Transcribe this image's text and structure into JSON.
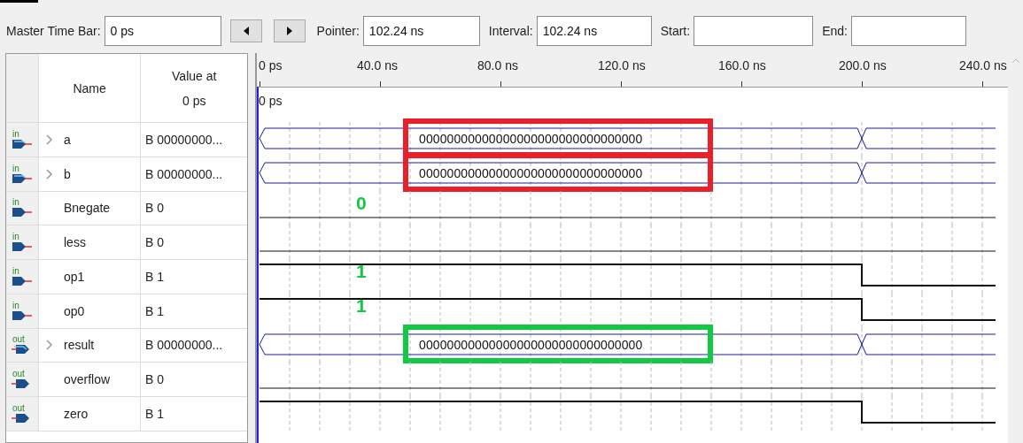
{
  "toolbar": {
    "master_time_bar": {
      "label": "Master Time Bar:",
      "value": "0 ps"
    },
    "buttons": [
      {
        "kind": "left"
      },
      {
        "kind": "right"
      }
    ],
    "pointer": {
      "label": "Pointer:",
      "value": "102.24 ns"
    },
    "interval": {
      "label": "Interval:",
      "value": "102.24 ns"
    },
    "start": {
      "label": "Start:"
    },
    "end": {
      "label": "End:"
    }
  },
  "table": {
    "columns": [
      "Name",
      "Value at\n0 ps"
    ]
  },
  "timeline": {
    "ticks": [
      "0 ps",
      "40.0 ns",
      "80.0 ns",
      "120.0 ns",
      "160.0 ns",
      "200.0 ns",
      "240.0 ns"
    ],
    "cursor": "0 ps"
  },
  "signals": [
    {
      "direction": "in",
      "kind": "bus",
      "expandable": true,
      "name": "a",
      "value": "B 00000000...",
      "bus_text": "00000000000000000000000000000000",
      "annotation": {
        "kind": "box",
        "color": "#e8202a"
      }
    },
    {
      "direction": "in",
      "kind": "bus",
      "expandable": true,
      "name": "b",
      "value": "B 00000000...",
      "bus_text": "00000000000000000000000000000000",
      "annotation": {
        "kind": "box",
        "color": "#e8202a"
      }
    },
    {
      "direction": "in",
      "kind": "bit",
      "expandable": false,
      "name": "Bnegate",
      "value": "B 0",
      "starts_high": false,
      "ends_high": false,
      "annotation": {
        "kind": "label",
        "color": "#12c944",
        "text": "0"
      }
    },
    {
      "direction": "in",
      "kind": "bit",
      "expandable": false,
      "name": "less",
      "value": "B 0",
      "starts_high": false,
      "ends_high": false
    },
    {
      "direction": "in",
      "kind": "bit",
      "expandable": false,
      "name": "op1",
      "value": "B 1",
      "starts_high": true,
      "ends_high": false,
      "annotation": {
        "kind": "label",
        "color": "#12c944",
        "text": "1"
      }
    },
    {
      "direction": "in",
      "kind": "bit",
      "expandable": false,
      "name": "op0",
      "value": "B 1",
      "starts_high": true,
      "ends_high": false,
      "annotation": {
        "kind": "label",
        "color": "#12c944",
        "text": "1"
      }
    },
    {
      "direction": "out",
      "kind": "bus",
      "expandable": true,
      "name": "result",
      "value": "B 00000000...",
      "bus_text": "00000000000000000000000000000000",
      "annotation": {
        "kind": "box",
        "color": "#12c944"
      }
    },
    {
      "direction": "out",
      "kind": "bit",
      "expandable": false,
      "name": "overflow",
      "value": "B 0",
      "starts_high": false,
      "ends_high": false
    },
    {
      "direction": "out",
      "kind": "bit",
      "expandable": false,
      "name": "zero",
      "value": "B 1",
      "starts_high": true,
      "ends_high": false
    }
  ]
}
